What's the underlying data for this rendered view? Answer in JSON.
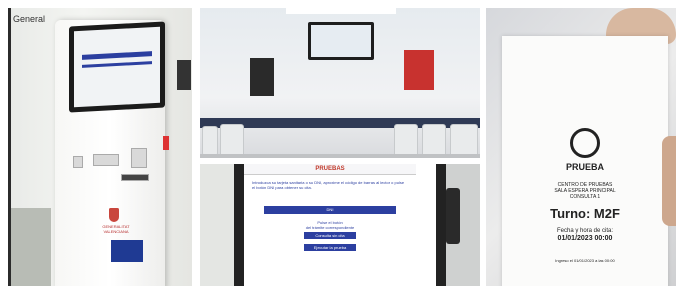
{
  "panel1": {
    "corner_label": "General",
    "screen_header": "",
    "brand_line1": "GENERALITAT",
    "brand_line2": "VALENCIANA"
  },
  "panel3": {
    "header": "PRUEBAS",
    "intro": "Introduzca su tarjeta sanitaria o su DNI, aproxime el código de barras al lector o pulse el botón DNI para obtener su cita.",
    "btn_dni": "DNI",
    "mid_line1": "Pulse el botón",
    "mid_line2": "del trámite correspondiente",
    "btn_consulta": "Consulta sin cita",
    "btn_prueba": "Ejecutar la prueba"
  },
  "ticket": {
    "brand": "PRUEBA",
    "center_line1": "CENTRO DE PRUEBAS",
    "center_line2": "SALA ESPERA PRINCIPAL",
    "center_line3": "CONSULTA 1",
    "turno": "Turno: M2F",
    "cita_label": "Fecha y hora de cita:",
    "cita_value": "01/01/2023 00:00",
    "footer": "Ingreso el 01/01/2023 a las 00:00"
  }
}
